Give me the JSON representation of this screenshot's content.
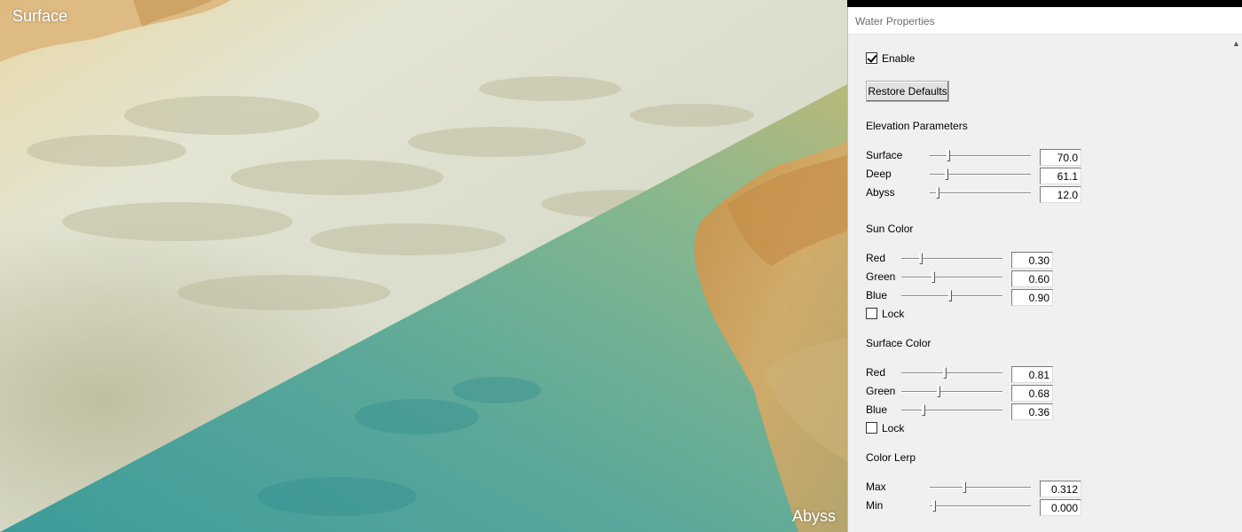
{
  "viewport": {
    "surface_label": "Surface",
    "abyss_label": "Abyss"
  },
  "panel": {
    "title": "Water Properties",
    "enable_label": "Enable",
    "enable_checked": true,
    "restore_defaults_label": "Restore Defaults",
    "elevation": {
      "heading": "Elevation Parameters",
      "surface": {
        "label": "Surface",
        "value": "70.0",
        "level": 0.17
      },
      "deep": {
        "label": "Deep",
        "value": "61.1",
        "level": 0.15
      },
      "abyss": {
        "label": "Abyss",
        "value": "12.0",
        "level": 0.06
      }
    },
    "sun_color": {
      "heading": "Sun Color",
      "red": {
        "label": "Red",
        "value": "0.30",
        "level": 0.18
      },
      "green": {
        "label": "Green",
        "value": "0.60",
        "level": 0.31
      },
      "blue": {
        "label": "Blue",
        "value": "0.90",
        "level": 0.48
      },
      "lock_label": "Lock",
      "lock_checked": false
    },
    "surface_color": {
      "heading": "Surface Color",
      "red": {
        "label": "Red",
        "value": "0.81",
        "level": 0.43
      },
      "green": {
        "label": "Green",
        "value": "0.68",
        "level": 0.36
      },
      "blue": {
        "label": "Blue",
        "value": "0.36",
        "level": 0.21
      },
      "lock_label": "Lock",
      "lock_checked": false
    },
    "color_lerp": {
      "heading": "Color Lerp",
      "max": {
        "label": "Max",
        "value": "0.312",
        "level": 0.34
      },
      "min": {
        "label": "Min",
        "value": "0.000",
        "level": 0.03
      }
    }
  },
  "colors": {
    "surface_water": "#dde1cc",
    "abyss_water": "#4fa59c",
    "terrain": "#d6a866",
    "panel_bg": "#f0f0f0"
  }
}
